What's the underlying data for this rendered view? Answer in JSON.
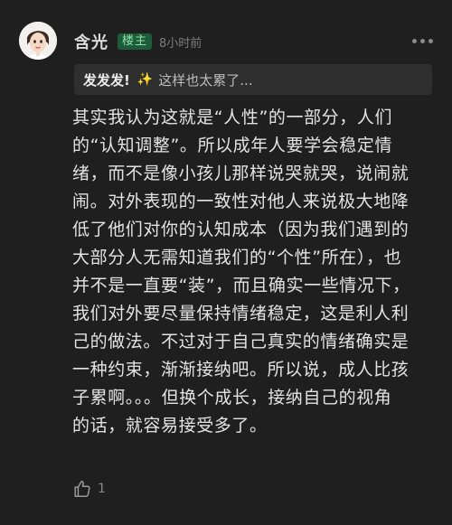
{
  "comment": {
    "username": "含光",
    "badge": "楼主",
    "time": "8小时前",
    "quote": {
      "author": "发发发!",
      "sparkle_icon": "sparkle-icon",
      "text": "这样也太累了..."
    },
    "content_lines": [
      "其实我认为这就是“人性”的一部分，人们",
      "的“认知调整”。所以成年人要学会稳定情",
      "绪，而不是像小孩儿那样说哭就哭，说闹就",
      "闹。对外表现的一致性对他人来说极大地降",
      "低了他们对你的认知成本（因为我们遇到的",
      "大部分人无需知道我们的“个性”所在），也",
      "并不是一直要“装”，而且确实一些情况下，",
      "我们对外要尽量保持情绪稳定，这是利人利",
      "己的做法。不过对于自己真实的情绪确实是",
      "一种约束，渐渐接纳吧。所以说，成人比孩",
      "子累啊。。。但换个成长，接纳自己的视角",
      "的话，就容易接受多了。"
    ],
    "like_count": "1"
  },
  "colors": {
    "background": "#1f1f1f",
    "badge_bg": "#1e5b3a",
    "badge_text": "#8fe1ab",
    "quote_bg": "#2f2f2f",
    "sparkle": "#f2c94c"
  }
}
